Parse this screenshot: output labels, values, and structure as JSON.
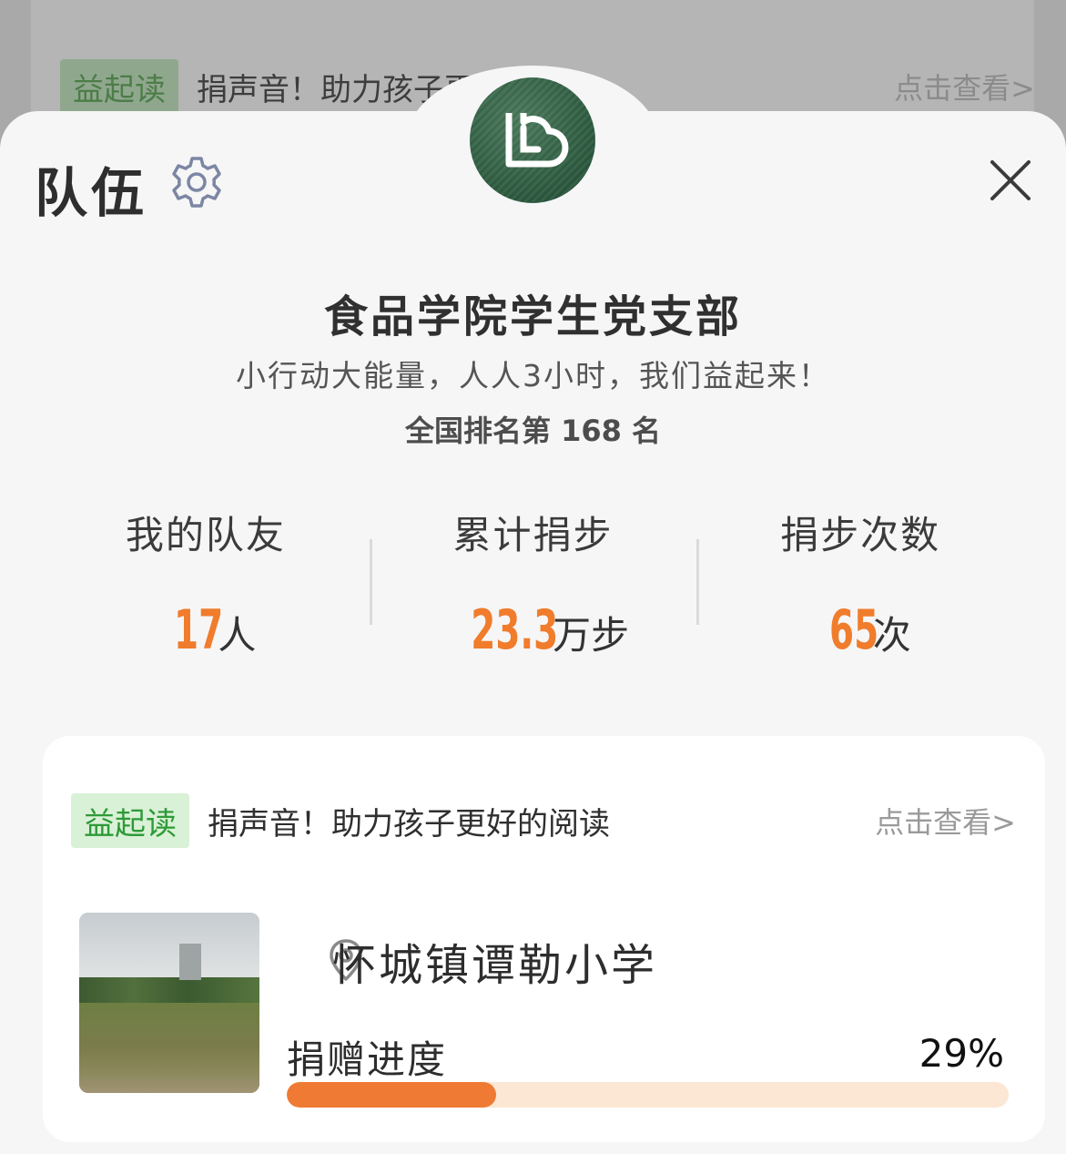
{
  "background_banner": {
    "tag": "益起读",
    "text": "捐声音！助力孩子更好的阅读",
    "link": "点击查看>"
  },
  "header": {
    "title": "队伍",
    "settings_icon": "gear-icon",
    "close_icon": "close-icon"
  },
  "team": {
    "name": "食品学院学生党支部",
    "slogan": "小行动大能量，人人3小时，我们益起来！",
    "rank": "全国排名第 168 名"
  },
  "stats": [
    {
      "label": "我的队友",
      "value": "17",
      "unit": "人"
    },
    {
      "label": "累计捐步",
      "value": "23.3",
      "unit": "万步"
    },
    {
      "label": "捐步次数",
      "value": "65",
      "unit": "次"
    }
  ],
  "project": {
    "tag": "益起读",
    "text": "捐声音！助力孩子更好的阅读",
    "link": "点击查看>",
    "school": "怀城镇谭勒小学",
    "progress_label": "捐赠进度",
    "progress_text": "29%",
    "progress": 0.29
  },
  "colors": {
    "accent": "#f07c2c",
    "tag_bg": "#d9f1d6",
    "tag_text": "#2e9a38",
    "progress_track": "#fbe7d4"
  }
}
